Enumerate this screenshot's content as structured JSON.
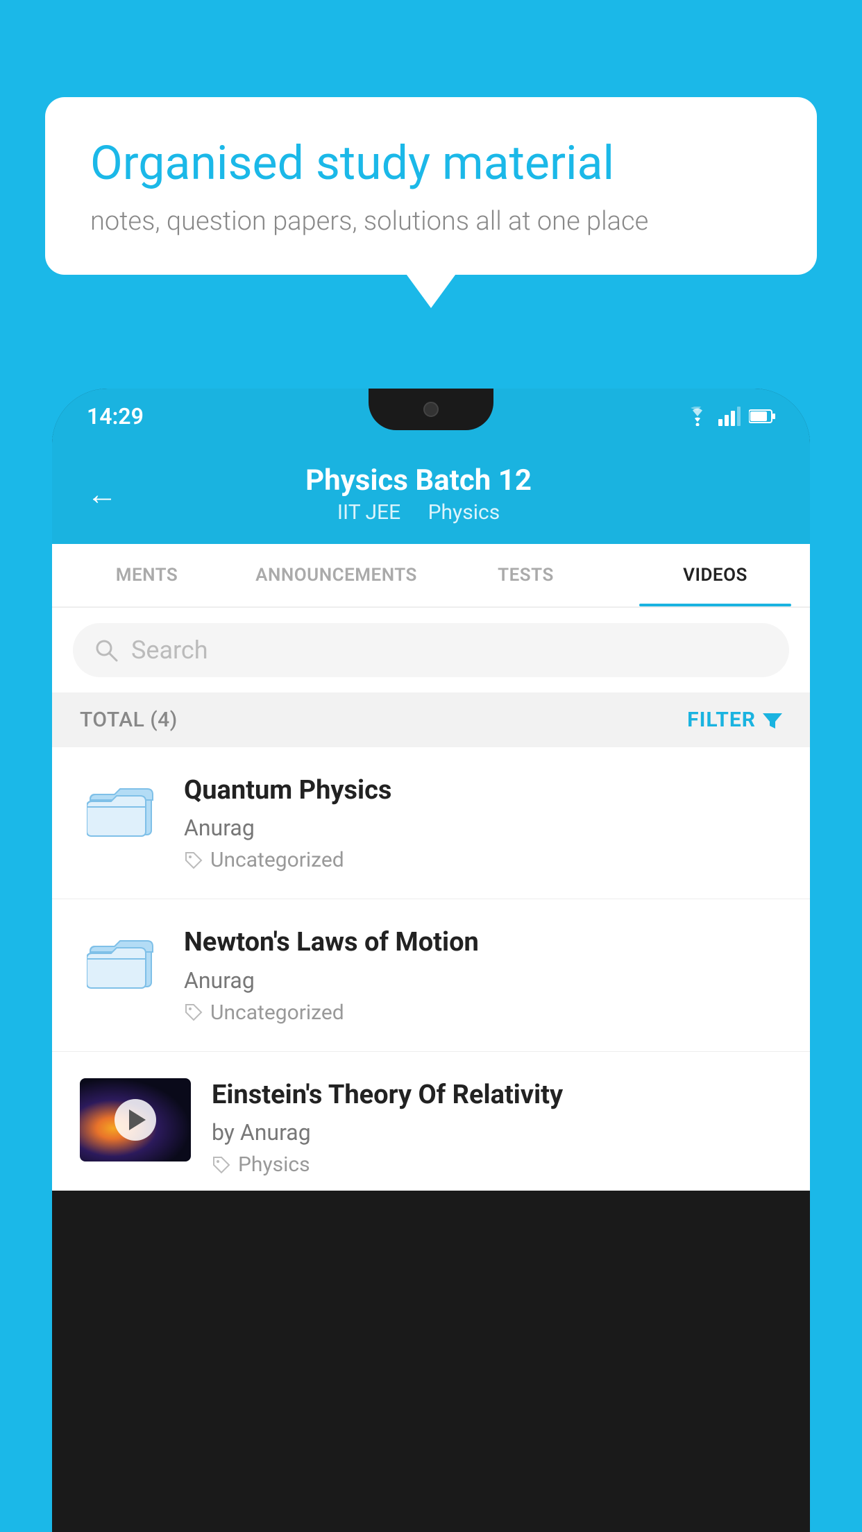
{
  "background_color": "#1bb8e8",
  "speech_bubble": {
    "title": "Organised study material",
    "subtitle": "notes, question papers, solutions all at one place"
  },
  "phone": {
    "status_bar": {
      "time": "14:29",
      "icons": [
        "wifi",
        "signal",
        "battery"
      ]
    },
    "header": {
      "back_label": "←",
      "title": "Physics Batch 12",
      "subtitle_parts": [
        "IIT JEE",
        "Physics"
      ]
    },
    "tabs": [
      {
        "label": "MENTS",
        "active": false
      },
      {
        "label": "ANNOUNCEMENTS",
        "active": false
      },
      {
        "label": "TESTS",
        "active": false
      },
      {
        "label": "VIDEOS",
        "active": true
      }
    ],
    "search": {
      "placeholder": "Search"
    },
    "filter_bar": {
      "total_label": "TOTAL (4)",
      "filter_label": "FILTER"
    },
    "videos": [
      {
        "title": "Quantum Physics",
        "author": "Anurag",
        "tag": "Uncategorized",
        "has_thumbnail": false
      },
      {
        "title": "Newton's Laws of Motion",
        "author": "Anurag",
        "tag": "Uncategorized",
        "has_thumbnail": false
      },
      {
        "title": "Einstein's Theory Of Relativity",
        "author": "by Anurag",
        "tag": "Physics",
        "has_thumbnail": true
      }
    ]
  }
}
